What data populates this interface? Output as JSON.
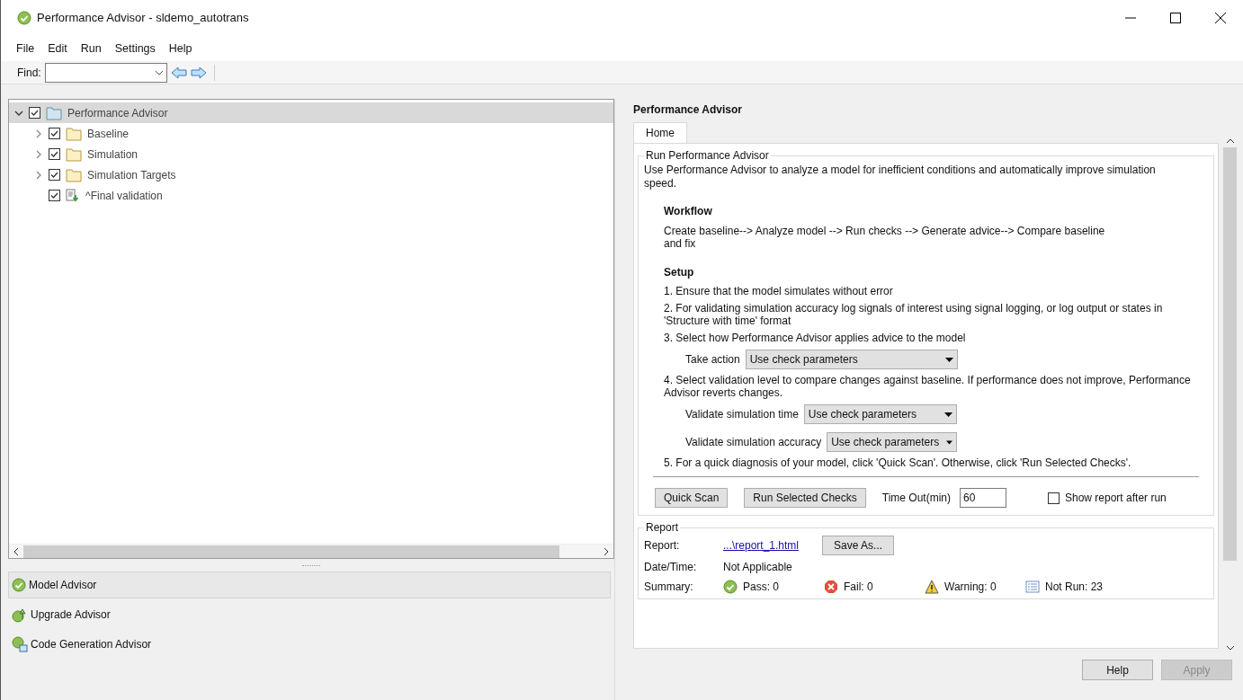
{
  "window": {
    "title": "Performance Advisor - sldemo_autotrans"
  },
  "menu": [
    "File",
    "Edit",
    "Run",
    "Settings",
    "Help"
  ],
  "toolbar": {
    "find_label": "Find:"
  },
  "tree": [
    {
      "label": "Performance Advisor",
      "kind": "root",
      "checked": true,
      "expanded": true,
      "selected": true,
      "children": [
        {
          "label": "Baseline",
          "kind": "folder",
          "checked": true,
          "expanded": false,
          "selected": false
        },
        {
          "label": "Simulation",
          "kind": "folder",
          "checked": true,
          "expanded": false,
          "selected": false
        },
        {
          "label": "Simulation Targets",
          "kind": "folder",
          "checked": true,
          "expanded": false,
          "selected": false
        },
        {
          "label": "^Final validation",
          "kind": "task",
          "checked": true,
          "selected": false
        }
      ]
    }
  ],
  "advisors": [
    {
      "label": "Model Advisor",
      "kind": "model",
      "selected": true
    },
    {
      "label": "Upgrade Advisor",
      "kind": "upgrade",
      "selected": false
    },
    {
      "label": "Code Generation Advisor",
      "kind": "codegen",
      "selected": false
    }
  ],
  "panel": {
    "title": "Performance Advisor",
    "tabs": [
      {
        "label": "Home",
        "selected": true
      }
    ],
    "run_group": {
      "title": "Run Performance Advisor",
      "intro": "Use Performance Advisor to analyze a model for inefficient conditions and automatically improve simulation speed.",
      "workflow_heading": "Workflow",
      "workflow_text": "Create baseline--> Analyze model --> Run checks --> Generate advice--> Compare baseline and fix",
      "setup_heading": "Setup",
      "steps": [
        {
          "text": "1. Ensure that the model simulates without error"
        },
        {
          "text": "2. For validating simulation accuracy log signals of interest using signal logging, or log output or states in 'Structure with time' format"
        },
        {
          "text": "3. Select how Performance Advisor applies advice to the model",
          "dropdowns": [
            {
              "label": "Take action",
              "value": "Use check parameters"
            }
          ]
        },
        {
          "text": "4. Select validation level to compare changes against baseline. If performance does not improve, Performance Advisor reverts changes.",
          "dropdowns": [
            {
              "label": "Validate simulation time",
              "value": "Use check parameters"
            },
            {
              "label": "Validate simulation accuracy",
              "value": "Use check parameters"
            }
          ]
        },
        {
          "text": "5. For a quick diagnosis of your model, click 'Quick Scan'. Otherwise, click 'Run Selected Checks'."
        }
      ],
      "buttons": [
        "Quick Scan",
        "Run Selected Checks"
      ],
      "timeout": {
        "label": "Time Out(min)",
        "value": "60"
      },
      "show_report": {
        "label": "Show report after run",
        "checked": false
      }
    },
    "report_group": {
      "title": "Report",
      "report_label": "Report:",
      "report_link": "...\\report_1.html",
      "save_button": "Save As...",
      "date_label": "Date/Time:",
      "date_value": "Not Applicable",
      "summary_label": "Summary:",
      "summary": [
        {
          "kind": "pass",
          "text": "Pass: 0"
        },
        {
          "kind": "fail",
          "text": "Fail: 0"
        },
        {
          "kind": "warning",
          "text": "Warning: 0"
        },
        {
          "kind": "notrun",
          "text": "Not Run: 23"
        }
      ]
    }
  },
  "footer_buttons": [
    {
      "label": "Help",
      "disabled": false
    },
    {
      "label": "Apply",
      "disabled": true
    }
  ]
}
